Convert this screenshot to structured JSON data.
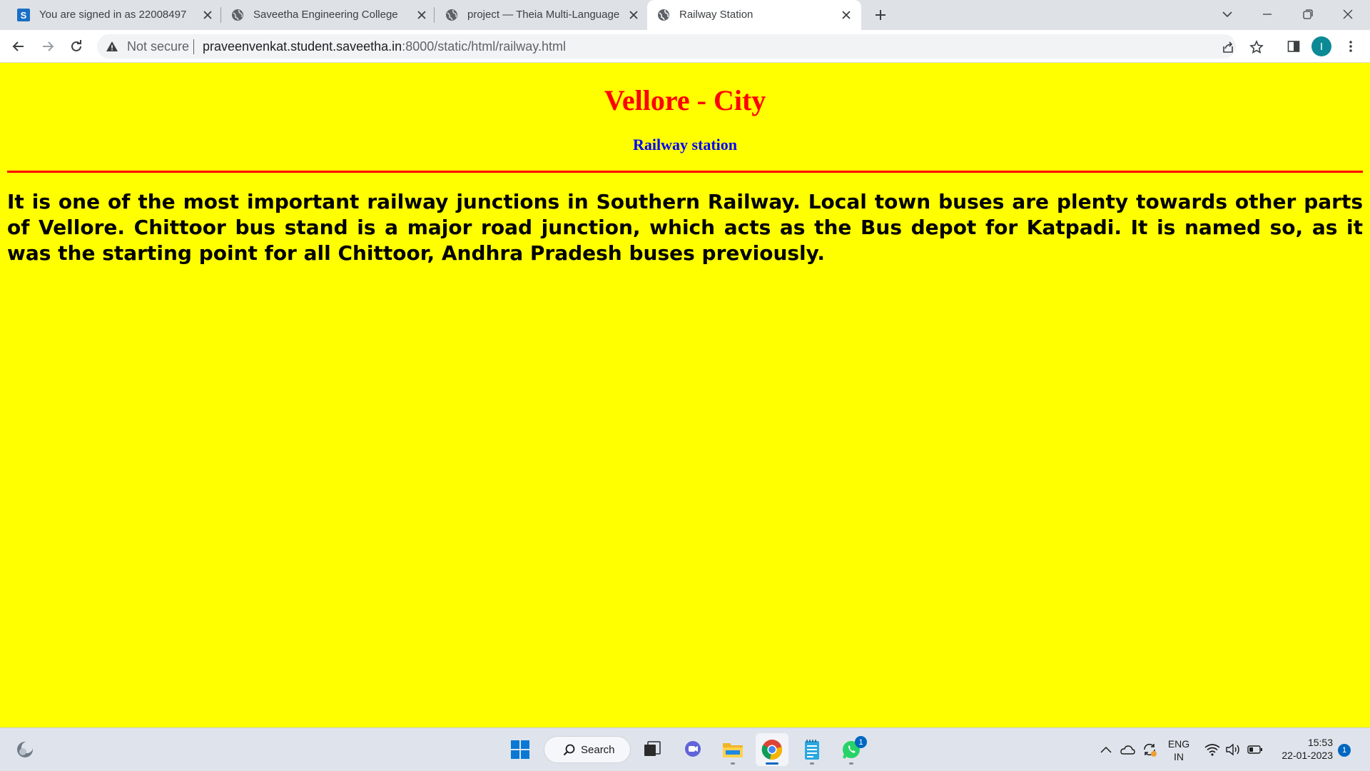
{
  "browser": {
    "tabs": [
      {
        "title": "You are signed in as 22008497",
        "favicon": "saveetha-s-icon",
        "active": false
      },
      {
        "title": "Saveetha Engineering College",
        "favicon": "globe-icon",
        "active": false
      },
      {
        "title": "project — Theia Multi-Language",
        "favicon": "globe-icon",
        "active": false
      },
      {
        "title": "Railway Station",
        "favicon": "globe-icon",
        "active": true
      }
    ],
    "address_bar": {
      "security_label": "Not secure",
      "url_host": "praveenvenkat.student.saveetha.in",
      "url_path": ":8000/static/html/railway.html"
    },
    "profile_initial": "I"
  },
  "page": {
    "title": "Vellore - City",
    "subtitle": "Railway station",
    "body": "It is one of the most important railway junctions in Southern Railway. Local town buses are plenty towards other parts of Vellore. Chittoor bus stand is a major road junction, which acts as the Bus depot for Katpadi. It is named so, as it was the starting point for all Chittoor, Andhra Pradesh buses previously.",
    "colors": {
      "background": "#ffff00",
      "title": "#ff0000",
      "subtitle": "#0000ff",
      "rule": "#ff0000",
      "body": "#000000"
    }
  },
  "taskbar": {
    "search_label": "Search",
    "whatsapp_badge": "1",
    "language_line1": "ENG",
    "language_line2": "IN",
    "time": "15:53",
    "date": "22-01-2023",
    "notification_count": "1"
  }
}
